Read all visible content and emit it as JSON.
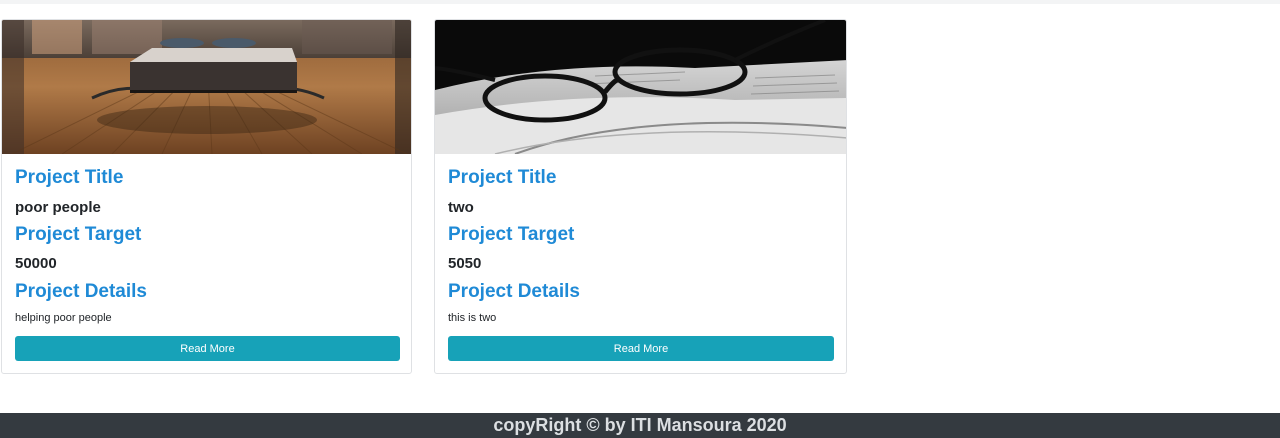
{
  "projects": [
    {
      "image": "bedroom-floor-image",
      "title_label": "Project Title",
      "title": "poor people",
      "target_label": "Project Target",
      "target": "50000",
      "details_label": "Project Details",
      "details": "helping poor people",
      "button": "Read More"
    },
    {
      "image": "book-glasses-image",
      "title_label": "Project Title",
      "title": "two",
      "target_label": "Project Target",
      "target": "5050",
      "details_label": "Project Details",
      "details": "this is two",
      "button": "Read More"
    }
  ],
  "colors": {
    "label": "#1f8ad6",
    "button": "#17a2b8",
    "footer_bg": "#343a40"
  },
  "footer": {
    "text": "copyRight © by ITI Mansoura 2020"
  }
}
